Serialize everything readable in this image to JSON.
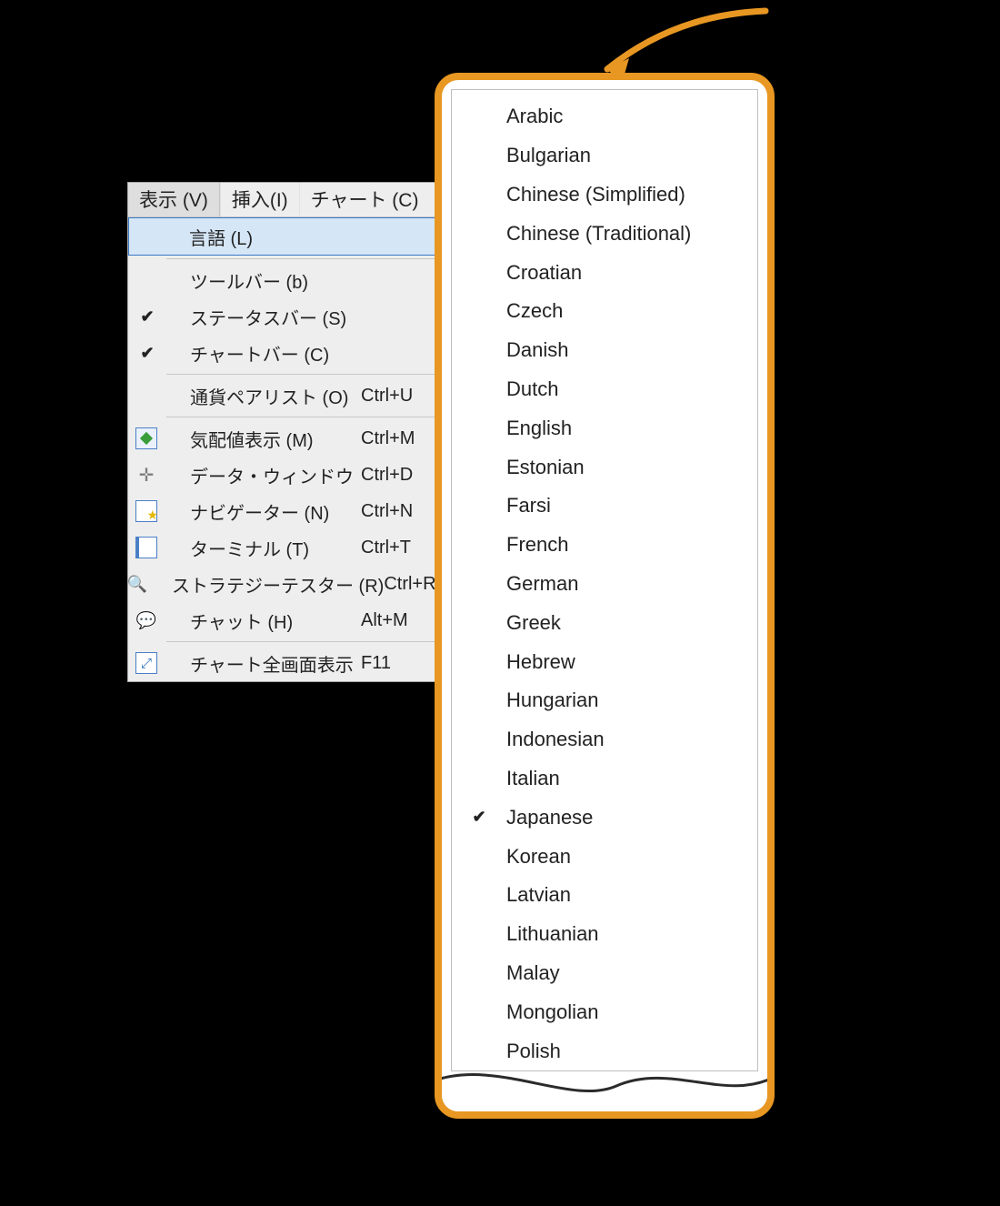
{
  "colors": {
    "callout_border": "#e79722",
    "highlight_bg": "#d5e6f6",
    "highlight_border": "#3a78c8"
  },
  "menubar": [
    {
      "label": "表示 (V)",
      "active": true
    },
    {
      "label": "挿入(I)",
      "active": false
    },
    {
      "label": "チャート (C)",
      "active": false
    }
  ],
  "view_menu": [
    {
      "kind": "item",
      "label": "言語 (L)",
      "shortcut": "",
      "checked": false,
      "icon": null,
      "highlight": true,
      "submenu": true
    },
    {
      "kind": "sep"
    },
    {
      "kind": "item",
      "label": "ツールバー (b)",
      "shortcut": "",
      "checked": false,
      "icon": null
    },
    {
      "kind": "item",
      "label": "ステータスバー (S)",
      "shortcut": "",
      "checked": true,
      "icon": null
    },
    {
      "kind": "item",
      "label": "チャートバー (C)",
      "shortcut": "",
      "checked": true,
      "icon": null
    },
    {
      "kind": "sep"
    },
    {
      "kind": "item",
      "label": "通貨ペアリスト (O)",
      "shortcut": "Ctrl+U",
      "checked": false,
      "icon": null
    },
    {
      "kind": "sep"
    },
    {
      "kind": "item",
      "label": "気配値表示 (M)",
      "shortcut": "Ctrl+M",
      "checked": false,
      "icon": "market"
    },
    {
      "kind": "item",
      "label": "データ・ウィンドウ",
      "shortcut": "Ctrl+D",
      "checked": false,
      "icon": "crosshair"
    },
    {
      "kind": "item",
      "label": "ナビゲーター (N)",
      "shortcut": "Ctrl+N",
      "checked": false,
      "icon": "nav"
    },
    {
      "kind": "item",
      "label": "ターミナル (T)",
      "shortcut": "Ctrl+T",
      "checked": false,
      "icon": "terminal"
    },
    {
      "kind": "item",
      "label": "ストラテジーテスター (R)",
      "shortcut": "Ctrl+R",
      "checked": false,
      "icon": "tester"
    },
    {
      "kind": "item",
      "label": "チャット (H)",
      "shortcut": "Alt+M",
      "checked": false,
      "icon": "chat"
    },
    {
      "kind": "sep"
    },
    {
      "kind": "item",
      "label": "チャート全画面表示",
      "shortcut": "F11",
      "checked": false,
      "icon": "full"
    }
  ],
  "languages": [
    {
      "label": "Arabic",
      "checked": false
    },
    {
      "label": "Bulgarian",
      "checked": false
    },
    {
      "label": "Chinese (Simplified)",
      "checked": false
    },
    {
      "label": "Chinese (Traditional)",
      "checked": false
    },
    {
      "label": "Croatian",
      "checked": false
    },
    {
      "label": "Czech",
      "checked": false
    },
    {
      "label": "Danish",
      "checked": false
    },
    {
      "label": "Dutch",
      "checked": false
    },
    {
      "label": "English",
      "checked": false
    },
    {
      "label": "Estonian",
      "checked": false
    },
    {
      "label": "Farsi",
      "checked": false
    },
    {
      "label": "French",
      "checked": false
    },
    {
      "label": "German",
      "checked": false
    },
    {
      "label": "Greek",
      "checked": false
    },
    {
      "label": "Hebrew",
      "checked": false
    },
    {
      "label": "Hungarian",
      "checked": false
    },
    {
      "label": "Indonesian",
      "checked": false
    },
    {
      "label": "Italian",
      "checked": false
    },
    {
      "label": "Japanese",
      "checked": true
    },
    {
      "label": "Korean",
      "checked": false
    },
    {
      "label": "Latvian",
      "checked": false
    },
    {
      "label": "Lithuanian",
      "checked": false
    },
    {
      "label": "Malay",
      "checked": false
    },
    {
      "label": "Mongolian",
      "checked": false
    },
    {
      "label": "Polish",
      "checked": false
    }
  ]
}
